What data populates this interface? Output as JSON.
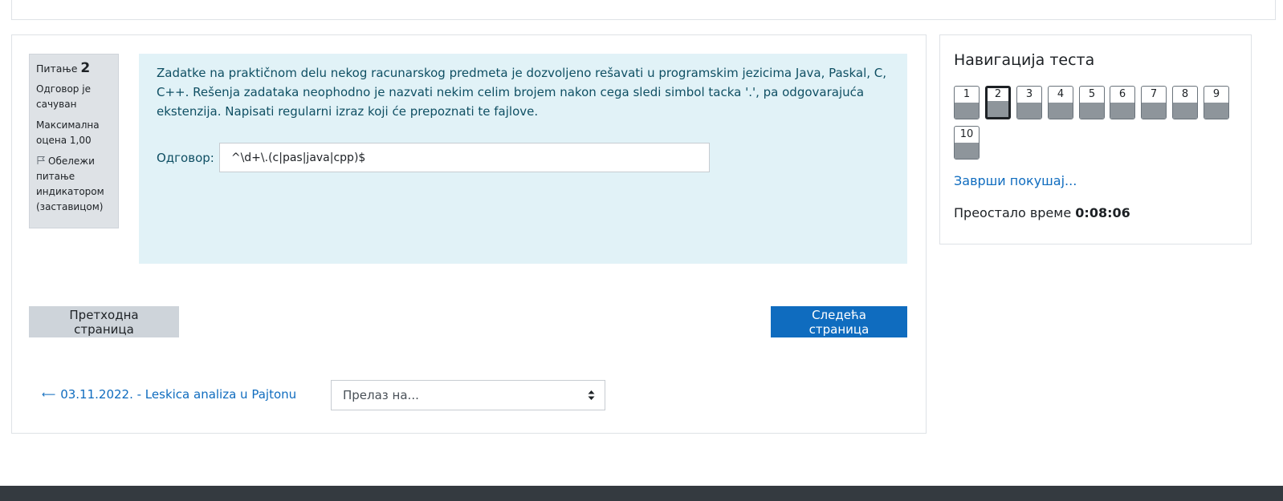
{
  "question_info": {
    "question_label": "Питање",
    "question_number": "2",
    "state": "Одговор је сачуван",
    "grade": "Максимална оцена 1,00",
    "flag_label": "Обележи питање индикатором (заставицом)"
  },
  "question": {
    "text": "Zadatke na praktičnom delu nekog racunarskog predmeta je dozvoljeno rešavati u programskim jezicima Java, Paskal, C, C++. Rešenja zadataka neophodno je nazvati nekim celim brojem nakon cega sledi simbol tacka '.', pa odgovarajuća ekstenzija. Napisati regularni izraz koji će prepoznati te fajlove.",
    "answer_label": "Одговор:",
    "answer_value": "^\\d+\\.(c|pas|java|cpp)$"
  },
  "buttons": {
    "prev_label": "Претходна страница",
    "next_label": "Следећа страница"
  },
  "activity_nav": {
    "prev_activity": "03.11.2022. - Leskica analiza u Pajtonu",
    "jump_placeholder": "Прелаз на..."
  },
  "quiz_nav": {
    "title": "Навигација теста",
    "questions": [
      "1",
      "2",
      "3",
      "4",
      "5",
      "6",
      "7",
      "8",
      "9",
      "10"
    ],
    "current": "2",
    "finish_link": "Заврши покушај...",
    "time_label": "Преостало време",
    "time_value": "0:08:06"
  },
  "colors": {
    "accent": "#0f6cbf",
    "question_bg": "#e1f2f7",
    "info_bg": "#dee2e6",
    "footer": "#343a40"
  }
}
